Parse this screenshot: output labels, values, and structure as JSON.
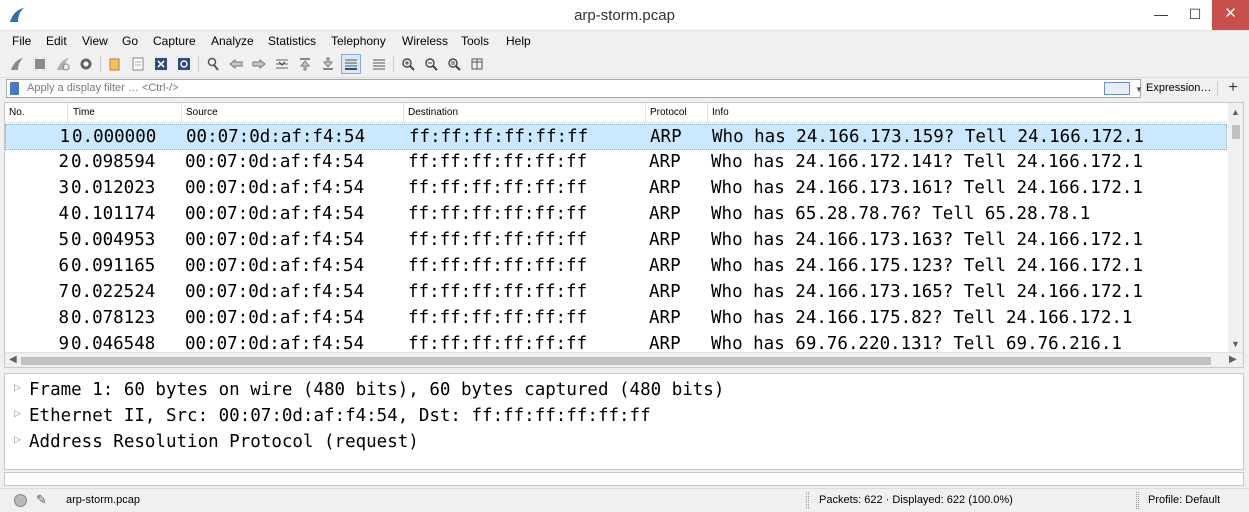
{
  "window": {
    "title": "arp-storm.pcap",
    "minimize": "—",
    "maximize": "☐",
    "close": "✕"
  },
  "menu": [
    "File",
    "Edit",
    "View",
    "Go",
    "Capture",
    "Analyze",
    "Statistics",
    "Telephony",
    "Wireless",
    "Tools",
    "Help"
  ],
  "toolbar": {
    "icons": [
      "shark-fin-start-icon",
      "stop-capture-icon",
      "restart-capture-icon",
      "capture-options-icon",
      "open-file-icon",
      "save-file-icon",
      "close-file-icon",
      "reload-file-icon",
      "find-packet-icon",
      "go-back-icon",
      "go-forward-icon",
      "go-to-packet-icon",
      "go-first-icon",
      "go-last-icon",
      "autoscroll-icon",
      "colorize-icon",
      "zoom-in-icon",
      "zoom-out-icon",
      "zoom-normal-icon",
      "resize-columns-icon"
    ]
  },
  "filter": {
    "placeholder": "Apply a display filter … <Ctrl-/>",
    "expression_label": "Expression…",
    "plus_label": "+"
  },
  "packet_list": {
    "columns": [
      "No.",
      "Time",
      "Source",
      "Destination",
      "Protocol",
      "Info"
    ],
    "rows": [
      {
        "no": "1",
        "time": "0.000000",
        "source": "00:07:0d:af:f4:54",
        "destination": "ff:ff:ff:ff:ff:ff",
        "protocol": "ARP",
        "info": "Who has 24.166.173.159? Tell 24.166.172.1"
      },
      {
        "no": "2",
        "time": "0.098594",
        "source": "00:07:0d:af:f4:54",
        "destination": "ff:ff:ff:ff:ff:ff",
        "protocol": "ARP",
        "info": "Who has 24.166.172.141? Tell 24.166.172.1"
      },
      {
        "no": "3",
        "time": "0.012023",
        "source": "00:07:0d:af:f4:54",
        "destination": "ff:ff:ff:ff:ff:ff",
        "protocol": "ARP",
        "info": "Who has 24.166.173.161? Tell 24.166.172.1"
      },
      {
        "no": "4",
        "time": "0.101174",
        "source": "00:07:0d:af:f4:54",
        "destination": "ff:ff:ff:ff:ff:ff",
        "protocol": "ARP",
        "info": "Who has 65.28.78.76? Tell 65.28.78.1"
      },
      {
        "no": "5",
        "time": "0.004953",
        "source": "00:07:0d:af:f4:54",
        "destination": "ff:ff:ff:ff:ff:ff",
        "protocol": "ARP",
        "info": "Who has 24.166.173.163? Tell 24.166.172.1"
      },
      {
        "no": "6",
        "time": "0.091165",
        "source": "00:07:0d:af:f4:54",
        "destination": "ff:ff:ff:ff:ff:ff",
        "protocol": "ARP",
        "info": "Who has 24.166.175.123? Tell 24.166.172.1"
      },
      {
        "no": "7",
        "time": "0.022524",
        "source": "00:07:0d:af:f4:54",
        "destination": "ff:ff:ff:ff:ff:ff",
        "protocol": "ARP",
        "info": "Who has 24.166.173.165? Tell 24.166.172.1"
      },
      {
        "no": "8",
        "time": "0.078123",
        "source": "00:07:0d:af:f4:54",
        "destination": "ff:ff:ff:ff:ff:ff",
        "protocol": "ARP",
        "info": "Who has 24.166.175.82? Tell 24.166.172.1"
      },
      {
        "no": "9",
        "time": "0.046548",
        "source": "00:07:0d:af:f4:54",
        "destination": "ff:ff:ff:ff:ff:ff",
        "protocol": "ARP",
        "info": "Who has 69.76.220.131? Tell 69.76.216.1"
      }
    ],
    "selected_row": "1",
    "selected_color": "#cce8ff"
  },
  "details": {
    "items": [
      "Frame 1: 60 bytes on wire (480 bits), 60 bytes captured (480 bits)",
      "Ethernet II, Src: 00:07:0d:af:f4:54, Dst: ff:ff:ff:ff:ff:ff",
      "Address Resolution Protocol (request)"
    ]
  },
  "status": {
    "file": "arp-storm.pcap",
    "packets": "Packets: 622 · Displayed: 622 (100.0%)",
    "profile": "Profile: Default"
  }
}
